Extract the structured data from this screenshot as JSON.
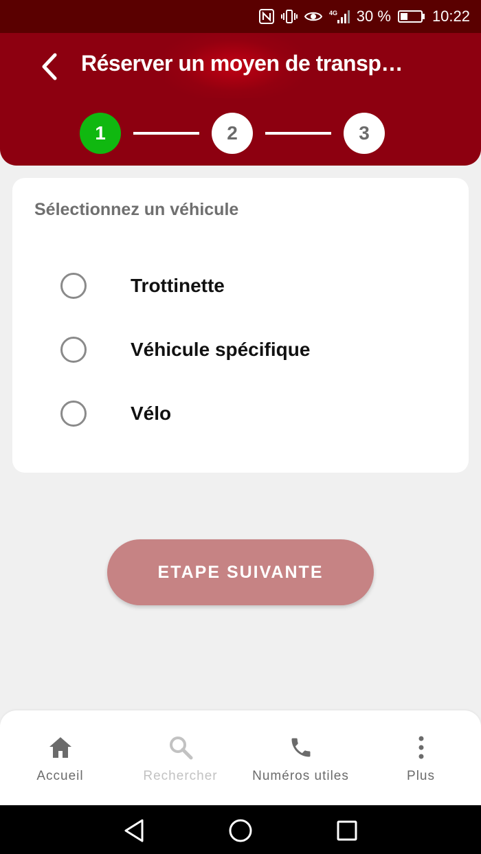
{
  "status_bar": {
    "battery": "30 %",
    "time": "10:22",
    "network": "4G"
  },
  "header": {
    "title": "Réserver un moyen de transp…",
    "background_color": "#8d0010"
  },
  "stepper": {
    "steps": [
      "1",
      "2",
      "3"
    ],
    "active_step": 1,
    "active_color": "#10b810"
  },
  "card": {
    "title": "Sélectionnez un véhicule",
    "options": [
      {
        "label": "Trottinette",
        "selected": false
      },
      {
        "label": "Véhicule spécifique",
        "selected": false
      },
      {
        "label": "Vélo",
        "selected": false
      }
    ]
  },
  "next_button": {
    "label": "ETAPE SUIVANTE",
    "color": "#c68384",
    "enabled": false
  },
  "bottom_nav": {
    "items": [
      {
        "label": "Accueil",
        "icon": "home-icon"
      },
      {
        "label": "Rechercher",
        "icon": "search-icon"
      },
      {
        "label": "Numéros utiles",
        "icon": "phone-icon"
      },
      {
        "label": "Plus",
        "icon": "more-vertical-icon"
      }
    ]
  },
  "android_nav": {
    "icons": [
      "back-triangle-icon",
      "home-circle-icon",
      "recents-square-icon"
    ]
  }
}
